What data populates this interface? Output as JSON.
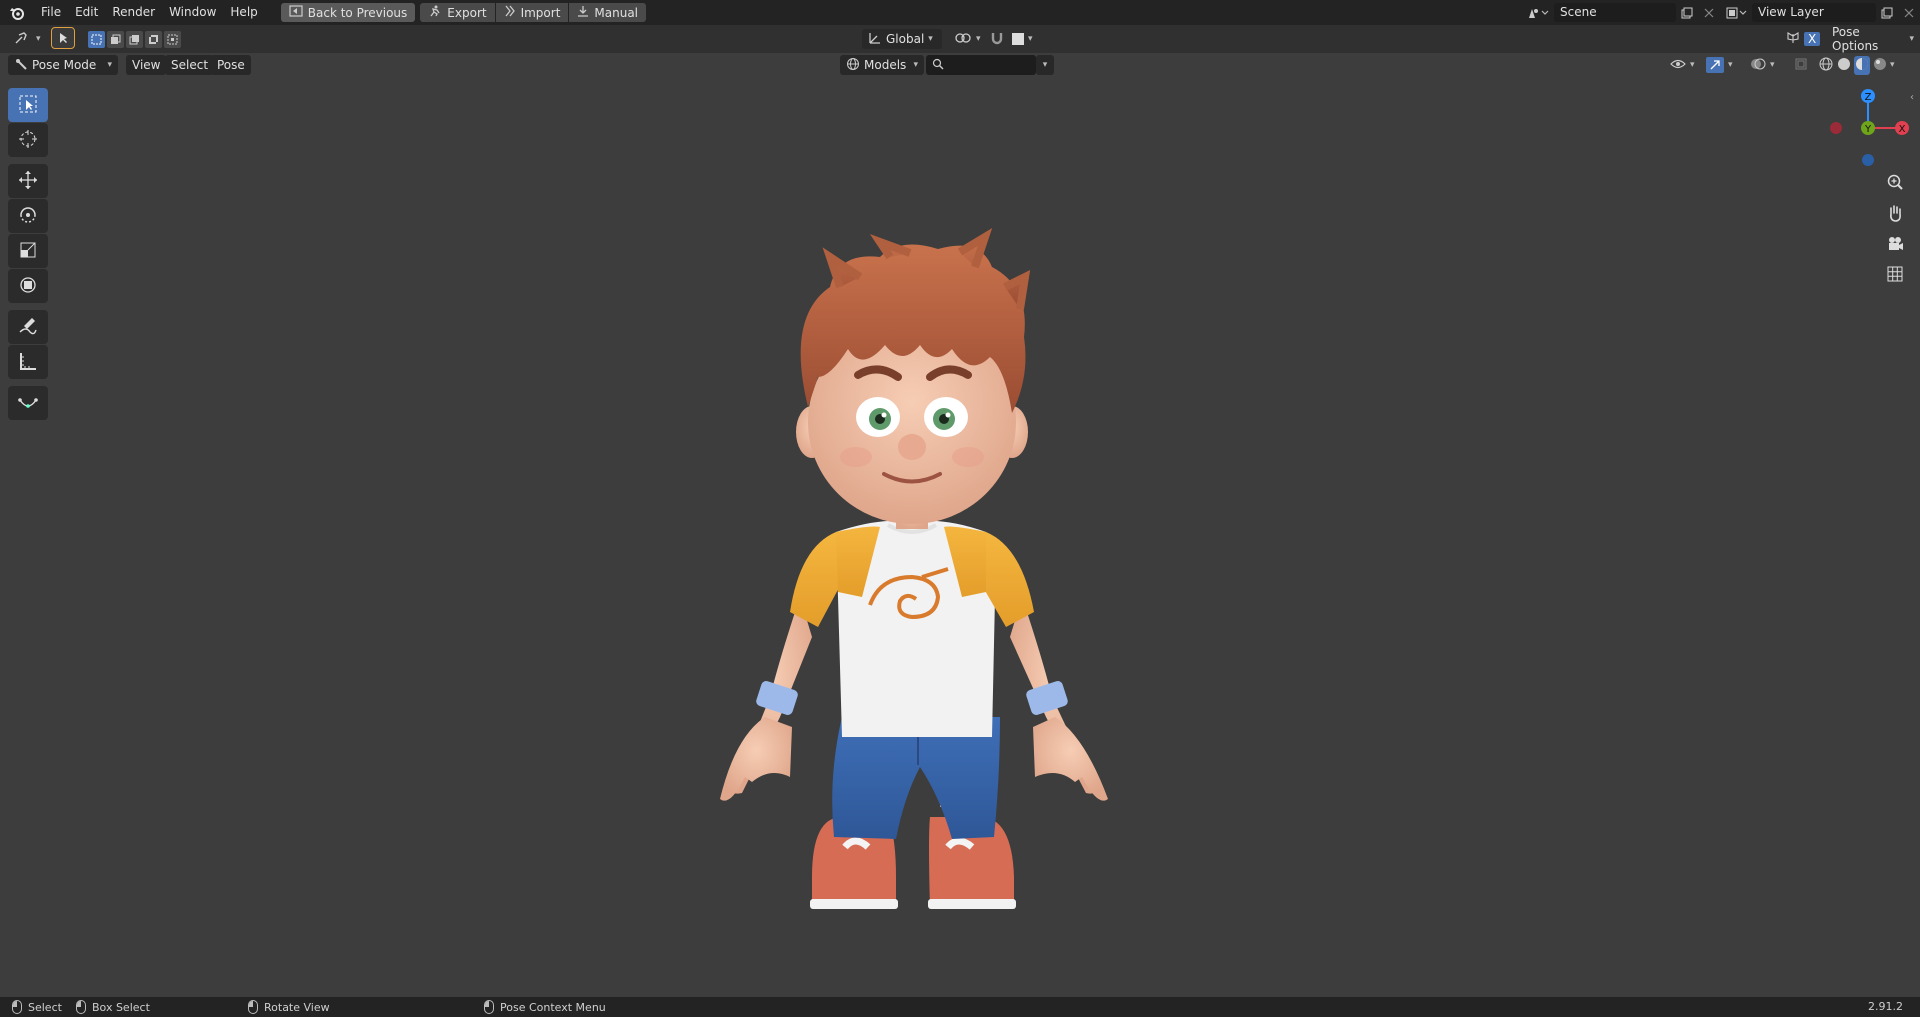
{
  "topbar": {
    "menus": [
      "File",
      "Edit",
      "Render",
      "Window",
      "Help"
    ],
    "back_button": "Back to Previous",
    "workspace_buttons": [
      "Export",
      "Import",
      "Manual"
    ],
    "scene_value": "Scene",
    "view_layer_value": "View Layer"
  },
  "tool_header": {
    "orientation": "Global",
    "pose_options": "Pose Options",
    "x_mirror": "X"
  },
  "viewport_header": {
    "mode": "Pose Mode",
    "menus": [
      "View",
      "Select",
      "Pose"
    ],
    "collection": "Models",
    "search_placeholder": ""
  },
  "toolbar": {
    "tools": [
      "select-box",
      "cursor",
      "move",
      "rotate",
      "scale",
      "transform",
      "annotate",
      "measure",
      "bone-envelope"
    ],
    "active": "select-box"
  },
  "gizmo": {
    "axes": [
      "X",
      "Y",
      "Z"
    ],
    "colors": {
      "x": "#e0404f",
      "y": "#6fa51b",
      "z": "#2c8fff"
    }
  },
  "statusbar": {
    "select": "Select",
    "box_select": "Box Select",
    "rotate_view": "Rotate View",
    "context_menu": "Pose Context Menu",
    "version": "2.91.2"
  },
  "colors": {
    "accent": "#4772b3",
    "viewport_bg": "#3d3d3d",
    "header_bg": "#303030",
    "topbar_bg": "#232323"
  }
}
